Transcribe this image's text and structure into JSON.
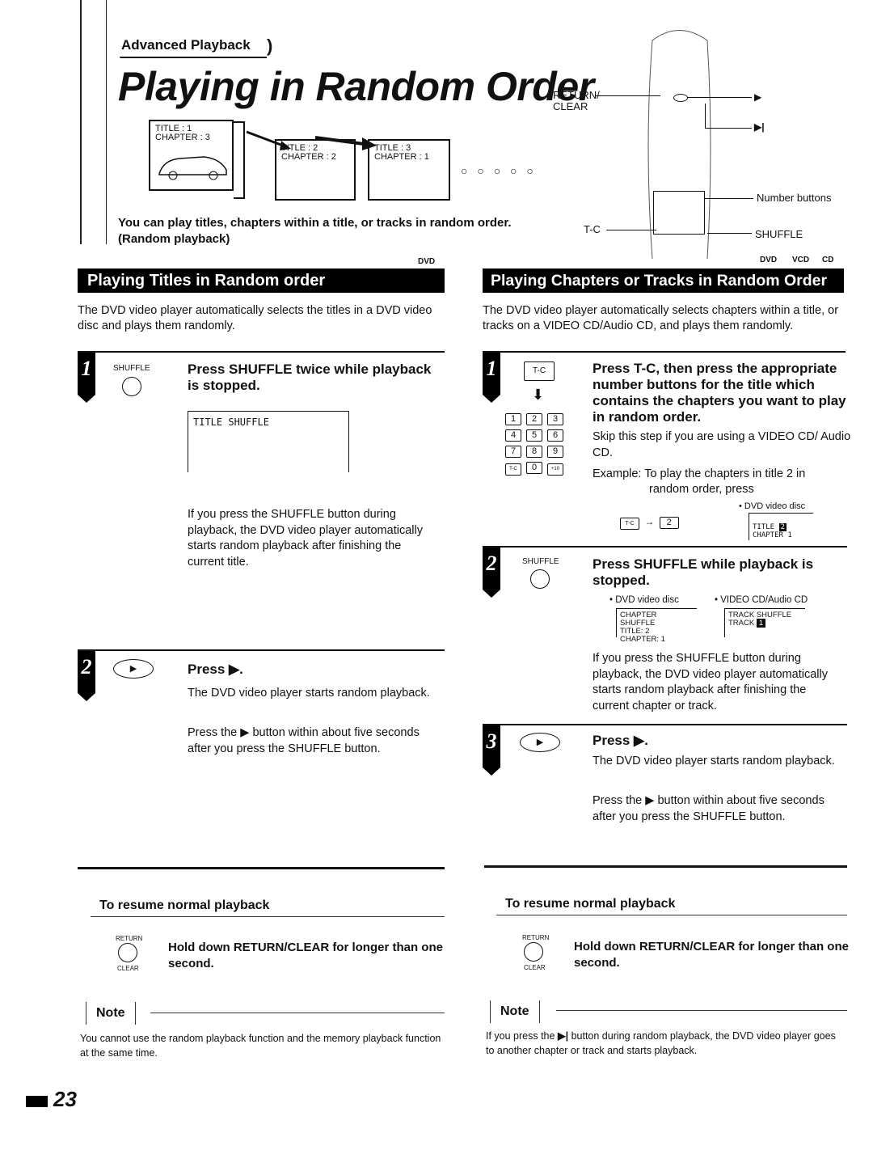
{
  "header": {
    "breadcrumb": "Advanced Playback",
    "title": "Playing in Random Order",
    "intro_line1": "You can play titles, chapters within a title, or tracks in random order.",
    "intro_line2": "(Random playback)",
    "illustration": {
      "screen1": [
        "TITLE : 1",
        "CHAPTER : 3"
      ],
      "screen2": [
        "TITLE : 2",
        "CHAPTER : 2"
      ],
      "screen3": [
        "TITLE : 3",
        "CHAPTER : 1"
      ],
      "continuation": "○ ○ ○ ○ ○"
    },
    "remote": {
      "return_clear_label": "RETURN/\nCLEAR",
      "return_label": "RETURN/",
      "clear_label": "CLEAR",
      "play_symbol": "▶",
      "skip_symbol": "▶|",
      "number_buttons_label": "Number buttons",
      "tc_label": "T-C",
      "shuffle_label": "SHUFFLE"
    }
  },
  "left": {
    "disc_badges": [
      "DVD"
    ],
    "band_title": "Playing Titles in Random order",
    "lead": "The DVD video player automatically selects the titles in a DVD video disc and plays them randomly.",
    "steps": [
      {
        "number": "1",
        "button_label": "SHUFFLE",
        "heading": "Press SHUFFLE twice while playback is stopped.",
        "screen_text": "TITLE SHUFFLE",
        "body": "If you press the SHUFFLE button during playback, the DVD video player automatically starts random playback after finishing the current title."
      },
      {
        "number": "2",
        "button_symbol": "▶",
        "heading": "Press ▶.",
        "body1": "The DVD video player starts random playback.",
        "body2": "Press the ▶ button within about five seconds after you press the SHUFFLE button."
      }
    ],
    "resume": {
      "heading": "To resume normal playback",
      "button_top": "RETURN",
      "button_bottom": "CLEAR",
      "text": "Hold down RETURN/CLEAR for longer than one second."
    },
    "note": {
      "label": "Note",
      "text": "You cannot use the random playback function and the memory playback function at the same time."
    }
  },
  "right": {
    "disc_badges": [
      "DVD",
      "VCD",
      "CD"
    ],
    "band_title": "Playing Chapters or Tracks in Random Order",
    "lead": "The DVD video player automatically selects chapters within a title, or tracks on a VIDEO CD/Audio CD, and plays them randomly.",
    "steps": [
      {
        "number": "1",
        "tc_key": "T-C",
        "arrow": "⬇",
        "keypad": [
          "1",
          "2",
          "3",
          "4",
          "5",
          "6",
          "7",
          "8",
          "9",
          "T-C",
          "0",
          "+10"
        ],
        "heading": "Press T-C, then press the appropriate number buttons for the title which contains the chapters you want to play in random order.",
        "body1": "Skip this step if you are using a VIDEO CD/ Audio CD.",
        "example": "Example: To play the chapters in title 2 in",
        "example2": "random order, press",
        "example_keys": [
          "T-C",
          "2"
        ],
        "example_arrow": "→",
        "disc_label": "• DVD video disc",
        "screen_line1": "TITLE",
        "screen_value": "2",
        "screen_line2": "CHAPTER   1"
      },
      {
        "number": "2",
        "button_label": "SHUFFLE",
        "heading": "Press SHUFFLE while playback is stopped.",
        "dvd_label": "• DVD video disc",
        "dvd_screen": [
          "CHAPTER SHUFFLE",
          "TITLE:  2",
          "CHAPTER:   1"
        ],
        "vcd_label": "• VIDEO CD/Audio CD",
        "vcd_screen_line1": "TRACK SHUFFLE",
        "vcd_screen_line2": "TRACK",
        "vcd_screen_value": "1",
        "body": "If you press the SHUFFLE button during playback, the DVD video player automatically starts random playback after finishing the current chapter or track."
      },
      {
        "number": "3",
        "button_symbol": "▶",
        "heading": "Press ▶.",
        "body1": "The DVD video player starts random playback.",
        "body2": "Press the ▶ button within about five seconds after you press the SHUFFLE button."
      }
    ],
    "resume": {
      "heading": "To resume normal playback",
      "button_top": "RETURN",
      "button_bottom": "CLEAR",
      "text": "Hold down RETURN/CLEAR for longer than one second."
    },
    "note": {
      "label": "Note",
      "text_before": "If you press the",
      "symbol": "▶|",
      "text_after": "button during random playback, the DVD video player goes to another chapter or track and starts playback."
    }
  },
  "footer": {
    "page_number": "23"
  }
}
